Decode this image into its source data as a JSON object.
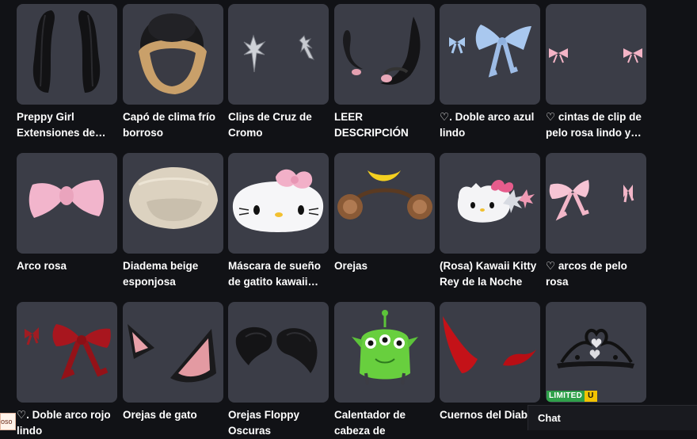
{
  "items": [
    {
      "name": "Preppy Girl\nExtensiones de…",
      "icon": "black-hair-extensions-icon"
    },
    {
      "name": "Capó de clima frío\nborroso",
      "icon": "fuzzy-hood-icon"
    },
    {
      "name": "Clips de Cruz de\nCromo",
      "icon": "chrome-cross-clips-icon"
    },
    {
      "name": "LEER DESCRIPCIÓN",
      "icon": "dark-horns-icon"
    },
    {
      "name": "♡. Doble arco azul\nlindo",
      "icon": "blue-bows-icon"
    },
    {
      "name": "♡ cintas de clip de\npelo rosa lindo y…",
      "icon": "pink-ribbons-icon"
    },
    {
      "name": "Arco rosa",
      "icon": "pink-bow-icon"
    },
    {
      "name": "Diadema beige\nesponjosa",
      "icon": "beige-headband-icon"
    },
    {
      "name": "Máscara de sueño\nde gatito kawaii…",
      "icon": "kitty-sleep-mask-icon"
    },
    {
      "name": "Orejas",
      "icon": "monkey-ears-icon"
    },
    {
      "name": "(Rosa) Kawaii Kitty\nRey de la Noche",
      "icon": "kitty-head-icon"
    },
    {
      "name": "♡ arcos de pelo\nrosa",
      "icon": "pink-hair-bows-icon"
    },
    {
      "name": "♡. Doble arco rojo\nlindo",
      "icon": "red-bows-icon"
    },
    {
      "name": "Orejas de gato",
      "icon": "cat-ears-icon"
    },
    {
      "name": "Orejas Floppy\nOscuras",
      "icon": "floppy-ears-icon"
    },
    {
      "name": "Calentador de\ncabeza de",
      "icon": "alien-hat-icon"
    },
    {
      "name": "Cuernos del Diab",
      "icon": "devil-horns-icon"
    },
    {
      "name": "",
      "icon": "black-tiara-icon",
      "badge": {
        "limited": "LIMITED",
        "u": "U"
      }
    }
  ],
  "chat": {
    "label": "Chat"
  },
  "edge_tag": {
    "label": "oso"
  },
  "colors": {
    "background": "#111216",
    "card": "#3b3d47",
    "limited": "#2fa04a",
    "u_badge": "#f2c200"
  }
}
